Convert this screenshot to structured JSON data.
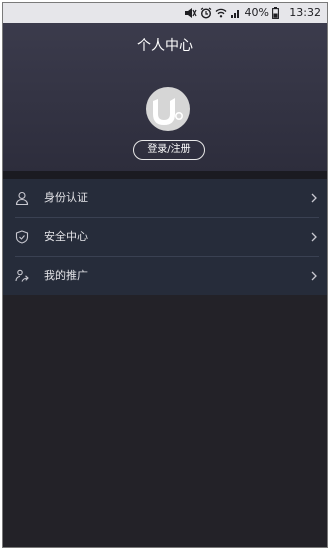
{
  "status_bar": {
    "battery": "40%",
    "time": "13:32",
    "icons": [
      "mute-icon",
      "alarm-icon",
      "wifi-icon",
      "signal-icon",
      "battery-icon"
    ]
  },
  "header": {
    "title": "个人中心",
    "avatar_icon": "app-logo-avatar",
    "login_label": "登录/注册"
  },
  "menu": {
    "items": [
      {
        "label": "身份认证",
        "icon": "user-icon"
      },
      {
        "label": "安全中心",
        "icon": "shield-icon"
      },
      {
        "label": "我的推广",
        "icon": "share-icon"
      }
    ]
  },
  "colors": {
    "header_bg": "#343444",
    "menu_bg": "#262c3a",
    "page_bg": "#232228",
    "status_bg": "#e6e6ea"
  }
}
